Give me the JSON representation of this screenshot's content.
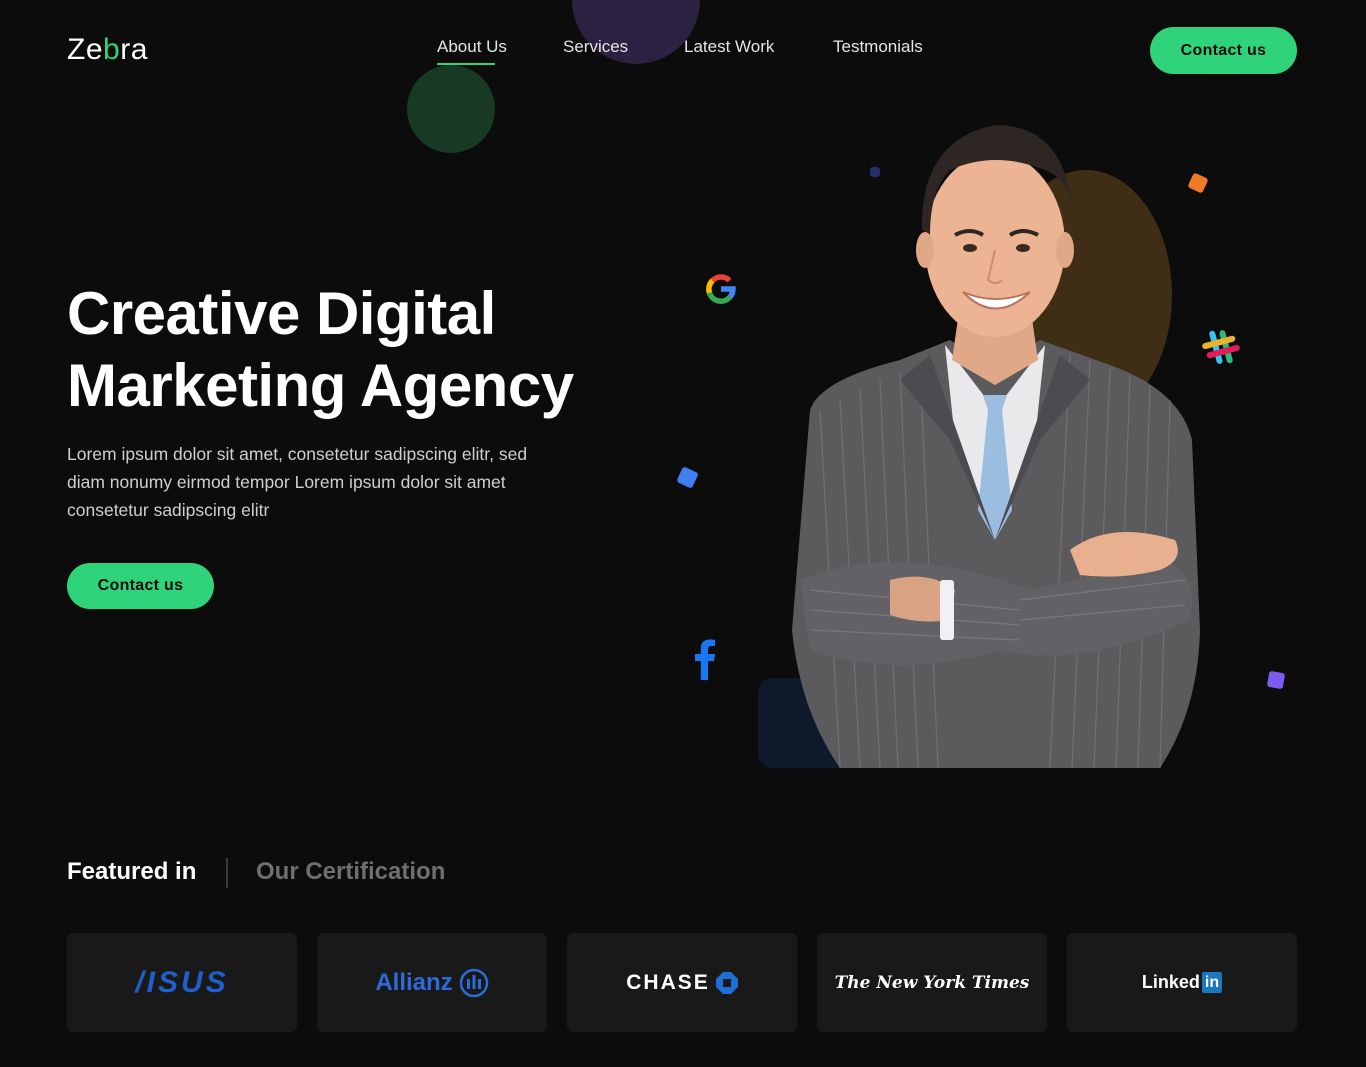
{
  "header": {
    "logo": {
      "part1": "Ze",
      "accent": "b",
      "part2": "ra"
    },
    "nav": [
      {
        "label": "About Us",
        "active": true
      },
      {
        "label": "Services"
      },
      {
        "label": "Latest Work"
      },
      {
        "label": "Testmonials"
      }
    ],
    "cta_label": "Contact us"
  },
  "hero": {
    "title_line1": "Creative Digital",
    "title_line2": "Marketing Agency",
    "description": "Lorem ipsum dolor sit amet, consetetur sadipscing elitr, sed diam nonumy eirmod tempor Lorem ipsum dolor sit amet consetetur sadipscing elitr",
    "cta_label": "Contact us",
    "floating_icons": [
      "google-icon",
      "slack-icon",
      "facebook-icon"
    ]
  },
  "featured": {
    "tabs": [
      {
        "label": "Featured in",
        "active": true
      },
      {
        "label": "Our Certification",
        "active": false
      }
    ],
    "logos": {
      "asus": "/ISUS",
      "allianz": "Allianz",
      "chase": "CHASE",
      "nyt": "The New York Times",
      "linkedin_text": "Linked",
      "linkedin_box": "in"
    }
  },
  "colors": {
    "background": "#0c0c0d",
    "accent": "#2fd47a",
    "text_muted": "#cfcfcf",
    "card": "#19191a"
  }
}
